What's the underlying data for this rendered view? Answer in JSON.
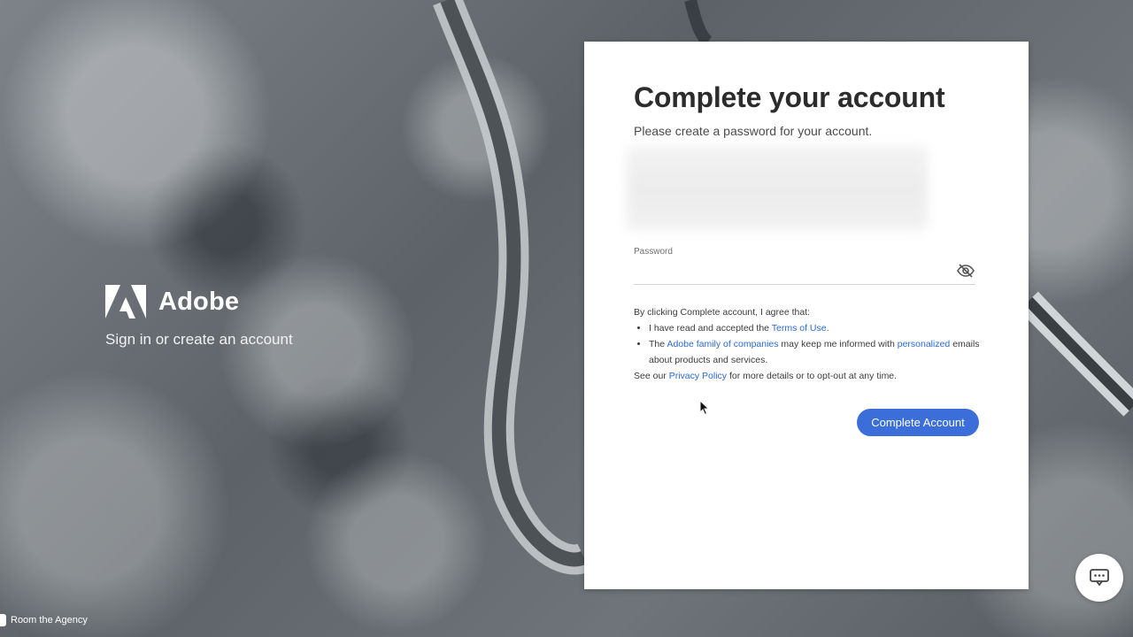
{
  "brand": {
    "name": "Adobe",
    "tagline": "Sign in or create an account"
  },
  "watermark": {
    "text": "Room the Agency"
  },
  "form": {
    "title": "Complete your account",
    "subtitle": "Please create a password for your account.",
    "password_label": "Password",
    "password_value": "",
    "show_password_icon": "eye-off-icon",
    "legal_intro": "By clicking Complete account, I agree that:",
    "bullet1_prefix": "I have read and accepted the ",
    "terms_link": "Terms of Use",
    "bullet1_suffix": ".",
    "bullet2_prefix": "The ",
    "family_link": "Adobe family of companies",
    "bullet2_middle": " may keep me informed with ",
    "personalized_link": "personalized",
    "bullet2_suffix": " emails about products and services.",
    "see_our": "See our ",
    "privacy_link": "Privacy Policy",
    "privacy_suffix": " for more details or to opt-out at any time.",
    "submit_label": "Complete Account"
  },
  "chat": {
    "icon": "chat-icon"
  },
  "colors": {
    "accent": "#3b6ed9",
    "link": "#2c6ad2"
  }
}
